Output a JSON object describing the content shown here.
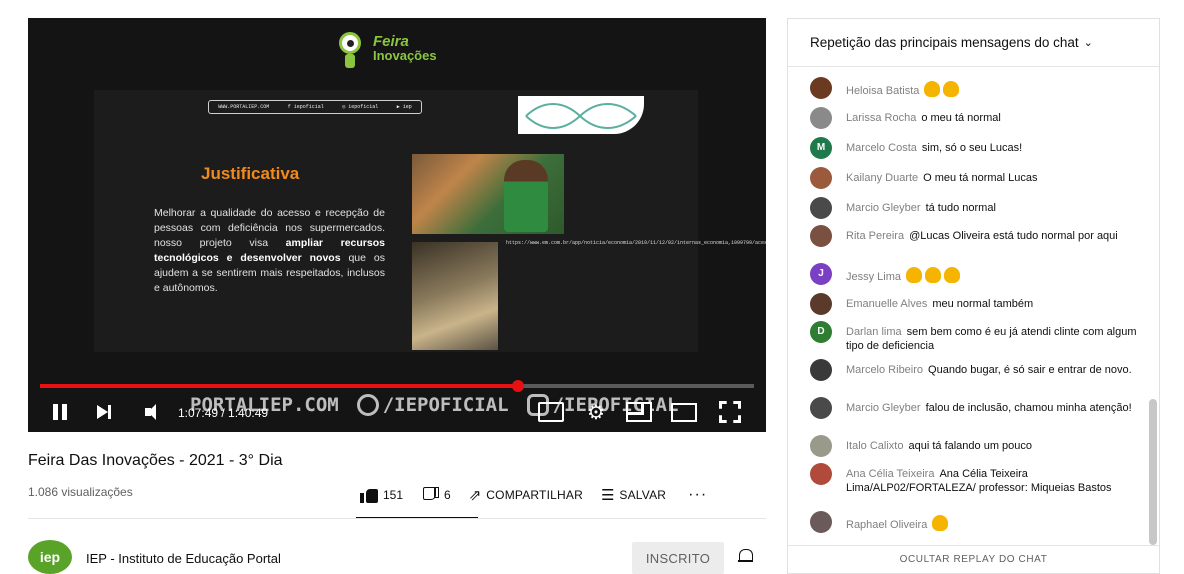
{
  "video": {
    "slide": {
      "logo_line1": "Feira",
      "logo_line2": "Inovações",
      "social_bar": [
        "WWW.PORTALIEP.COM",
        "f iepoficial",
        "◎ iepoficial",
        "▶ iep"
      ],
      "title": "Justificativa",
      "body_plain": "Melhorar a qualidade do acesso e recepção de pessoas com deficiência nos supermercados. nosso projeto visa ",
      "body_bold1": "ampliar recursos tecnológicos e desenvolver novos",
      "body_plain2": " que os ajudem a se sentirem mais respeitados, inclusos e autônomos.",
      "photo_caption": "https://www.em.com.br/app/noticia/economia/2019/11/12/02/internas_economia,1099799/acessos"
    },
    "watermark": {
      "site": "PORTALIEP.COM",
      "facebook": "/IEPOFICIAL",
      "instagram": "/IEPOFICIAL"
    },
    "progress_fraction": 0.67,
    "time": "1:07:49 / 1:40:49"
  },
  "info": {
    "title": "Feira Das Inovações - 2021 - 3° Dia",
    "views": "1.086 visualizações",
    "likes": "151",
    "dislikes": "6",
    "share_label": "COMPARTILHAR",
    "save_label": "SALVAR",
    "more_label": "···"
  },
  "channel": {
    "avatar_text": "iep",
    "name": "IEP - Instituto de Educação Portal",
    "subscribe_label": "INSCRITO"
  },
  "chat": {
    "header": "Repetição das principais mensagens do chat",
    "footer": "OCULTAR REPLAY DO CHAT",
    "messages": [
      {
        "author": "Heloisa Batista",
        "text": "",
        "emoji_count": 2,
        "avatar_color": "#6b3a20",
        "avatar_letter": ""
      },
      {
        "author": "Larissa Rocha",
        "text": "o meu tá normal",
        "emoji_count": 0,
        "avatar_color": "#8a8a8a",
        "avatar_letter": ""
      },
      {
        "author": "Marcelo Costa",
        "text": "sim, só o seu Lucas!",
        "emoji_count": 0,
        "avatar_color": "#1e7a4a",
        "avatar_letter": "M"
      },
      {
        "author": "Kailany Duarte",
        "text": "O meu tá normal Lucas",
        "emoji_count": 0,
        "avatar_color": "#9c5a3c",
        "avatar_letter": ""
      },
      {
        "author": "Marcio Gleyber",
        "text": "tá tudo normal",
        "emoji_count": 0,
        "avatar_color": "#4a4a4a",
        "avatar_letter": ""
      },
      {
        "author": "Rita Pereira",
        "text": "@Lucas Oliveira está tudo normal por aqui",
        "emoji_count": 0,
        "avatar_color": "#7a5040",
        "avatar_letter": ""
      },
      {
        "author": "Jessy Lima",
        "text": "",
        "emoji_count": 3,
        "avatar_color": "#7b3fc4",
        "avatar_letter": "J"
      },
      {
        "author": "Emanuelle Alves",
        "text": "meu normal também",
        "emoji_count": 0,
        "avatar_color": "#5a3a2a",
        "avatar_letter": ""
      },
      {
        "author": "Darlan lima",
        "text": "sem bem como é eu já atendi clinte com algum tipo de deficiencia",
        "emoji_count": 0,
        "avatar_color": "#2e7d32",
        "avatar_letter": "D"
      },
      {
        "author": "Marcelo Ribeiro",
        "text": "Quando bugar, é só sair e entrar de novo.",
        "emoji_count": 0,
        "avatar_color": "#3a3a3a",
        "avatar_letter": ""
      },
      {
        "author": "Marcio Gleyber",
        "text": "falou de inclusão, chamou minha atenção!",
        "emoji_count": 0,
        "avatar_color": "#4a4a4a",
        "avatar_letter": ""
      },
      {
        "author": "Italo Calixto",
        "text": "aqui tá falando um pouco",
        "emoji_count": 0,
        "avatar_color": "#9a9a8a",
        "avatar_letter": ""
      },
      {
        "author": "Ana Célia Teixeira",
        "text": "Ana Célia Teixeira Lima/ALP02/FORTALEZA/ professor: Miqueias Bastos",
        "emoji_count": 0,
        "avatar_color": "#b04a3a",
        "avatar_letter": ""
      },
      {
        "author": "Raphael Oliveira",
        "text": "",
        "emoji_count": 1,
        "avatar_color": "#6a5a5a",
        "avatar_letter": ""
      }
    ]
  }
}
